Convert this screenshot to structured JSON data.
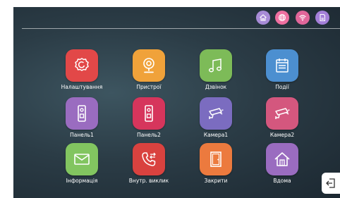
{
  "status_bar": {
    "icons": [
      {
        "name": "home-status-icon",
        "color": "#a78bd6"
      },
      {
        "name": "globe-icon",
        "color": "#ee6fa0"
      },
      {
        "name": "wifi-icon",
        "color": "#e0669a"
      },
      {
        "name": "sd-card-icon",
        "color": "#a47fd8"
      }
    ]
  },
  "apps": [
    {
      "label": "Налаштування",
      "icon": "gear-icon",
      "color": "#e24848"
    },
    {
      "label": "Пристрої",
      "icon": "camera-device-icon",
      "color": "#f0a23a"
    },
    {
      "label": "Дзвінок",
      "icon": "music-note-icon",
      "color": "#7dbb58"
    },
    {
      "label": "Події",
      "icon": "calendar-icon",
      "color": "#4c8fd0"
    },
    {
      "label": "Панель1",
      "icon": "doorbell-panel-icon",
      "color": "#9a6cc0"
    },
    {
      "label": "Панель2",
      "icon": "doorbell-panel-icon",
      "color": "#d6355c"
    },
    {
      "label": "Камера1",
      "icon": "cctv-camera-icon",
      "color": "#7b6cc0"
    },
    {
      "label": "Камера2",
      "icon": "cctv-camera-icon",
      "color": "#d4577e"
    },
    {
      "label": "Інформація",
      "icon": "envelope-icon",
      "color": "#82c560"
    },
    {
      "label": "Внутр. виклик",
      "icon": "phone-transfer-icon",
      "color": "#d9423f"
    },
    {
      "label": "Закрити",
      "icon": "door-icon",
      "color": "#ec7a3e"
    },
    {
      "label": "Вдома",
      "icon": "home-icon",
      "color": "#9a6cc0"
    }
  ],
  "exit_icon": "exit-icon"
}
